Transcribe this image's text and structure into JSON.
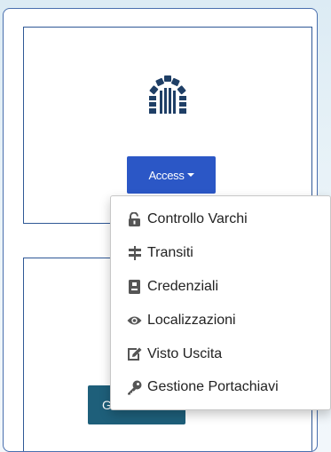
{
  "access": {
    "icon": "gate-arch-icon",
    "button_label": "Access"
  },
  "second_panel": {
    "button_label": "G"
  },
  "menu": {
    "items": [
      {
        "label": "Controllo Varchi",
        "icon": "lock-open-icon"
      },
      {
        "label": "Transiti",
        "icon": "signpost-icon"
      },
      {
        "label": "Credenziali",
        "icon": "id-badge-icon"
      },
      {
        "label": "Localizzazioni",
        "icon": "eye-icon"
      },
      {
        "label": "Visto Uscita",
        "icon": "edit-icon"
      },
      {
        "label": "Gestione Portachiavi",
        "icon": "key-icon"
      }
    ]
  },
  "colors": {
    "panel_border": "#2f5896",
    "access_button": "#2b57c6",
    "second_button": "#1e5f7a",
    "icon_color": "#1f3f66"
  }
}
